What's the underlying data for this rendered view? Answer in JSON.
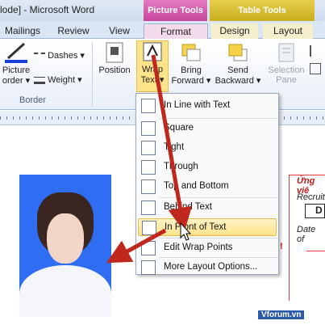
{
  "title": "lode] - Microsoft Word",
  "context_groups": {
    "picture_tools": "Picture Tools",
    "table_tools": "Table Tools"
  },
  "tabs": [
    "Mailings",
    "Review",
    "View",
    "Format",
    "Design",
    "Layout"
  ],
  "ribbon": {
    "picture_border": "Picture\norder ▾",
    "dashes": "Dashes ▾",
    "weight": "Weight ▾",
    "border_group": "Border",
    "position": "Position",
    "wrap_text": "Wrap\nText ▾",
    "bring_forward": "Bring\nForward ▾",
    "send_backward": "Send\nBackward ▾",
    "selection_pane": "Selection\nPane"
  },
  "menu": {
    "items": [
      "In Line with Text",
      "Square",
      "Tight",
      "Through",
      "Top and Bottom",
      "Behind Text",
      "In Front of Text",
      "Edit Wrap Points",
      "More Layout Options..."
    ],
    "highlighted": "In Front of Text"
  },
  "doc": {
    "form_title": "Ứng viê",
    "recruit": "Recruiti",
    "box_text": "D",
    "date_label": "Date of",
    "exclaim": "!"
  },
  "watermark": "Vforum.vn",
  "colors": {
    "arrow": "#c0281e",
    "picture_tools": "#c6439c",
    "table_tools": "#c9ad1f"
  }
}
